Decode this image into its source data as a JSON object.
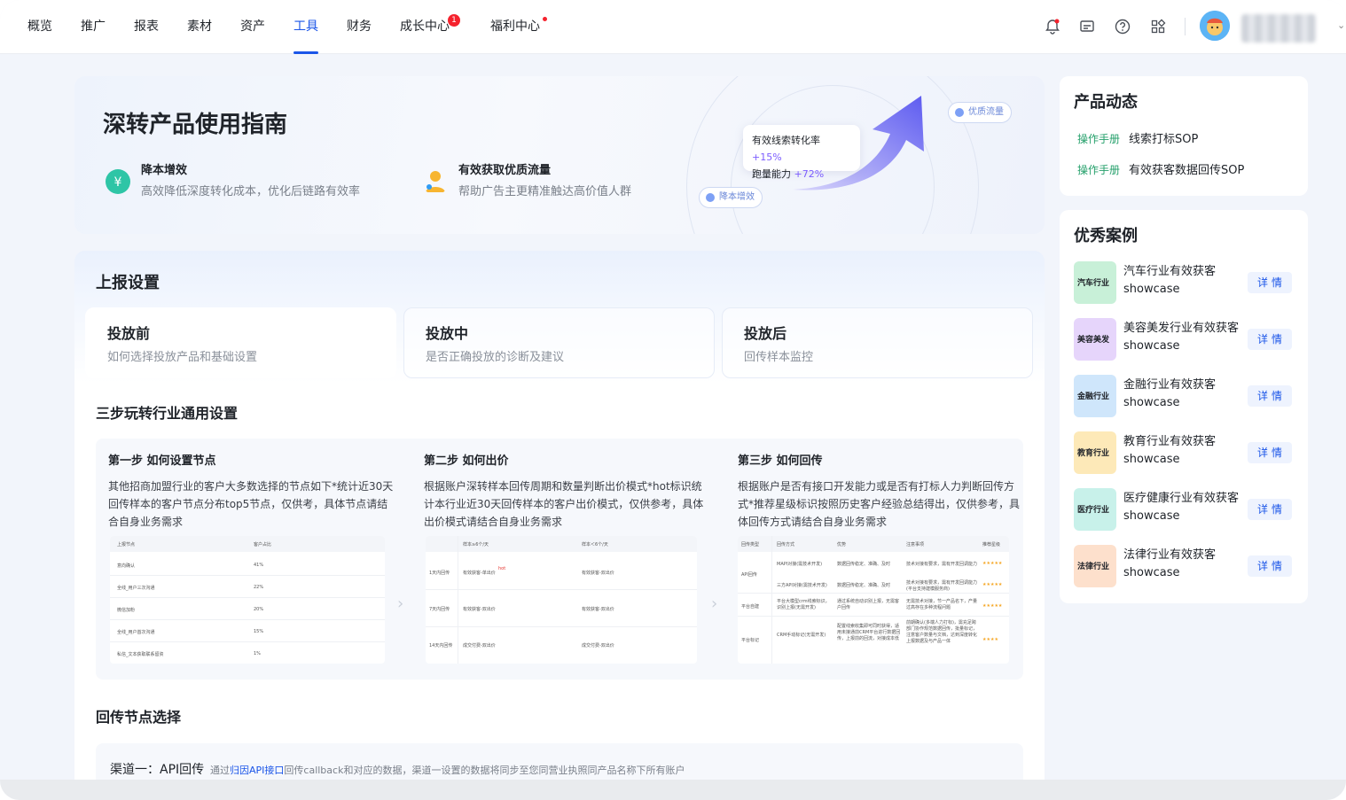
{
  "nav": {
    "items": [
      "概览",
      "推广",
      "报表",
      "素材",
      "资产",
      "工具",
      "财务",
      "成长中心",
      "福利中心"
    ],
    "active": "工具",
    "growth_badge": "1"
  },
  "toolbar": {
    "icons": [
      "bell-icon",
      "message-icon",
      "help-icon",
      "apps-icon"
    ]
  },
  "guide": {
    "title": "深转产品使用指南",
    "features": [
      {
        "title": "降本增效",
        "desc": "高效降低深度转化成本，优化后链路有效率",
        "icon": "yuan-icon"
      },
      {
        "title": "有效获取优质流量",
        "desc": "帮助广告主更精准触达高价值人群",
        "icon": "people-icon"
      }
    ],
    "card_line1_label": "有效线索转化率",
    "card_line1_value": "+15%",
    "card_line2_label": "跑量能力",
    "card_line2_value": "+72%",
    "pill_quality": "优质流量",
    "pill_cost": "降本增效"
  },
  "report": {
    "title": "上报设置",
    "tabs": [
      {
        "title": "投放前",
        "desc": "如何选择投放产品和基础设置"
      },
      {
        "title": "投放中",
        "desc": "是否正确投放的诊断及建议"
      },
      {
        "title": "投放后",
        "desc": "回传样本监控"
      }
    ],
    "steps_title": "三步玩转行业通用设置",
    "steps": [
      {
        "title": "第一步 如何设置节点",
        "desc": "其他招商加盟行业的客户大多数选择的节点如下*统计近30天回传样本的客户节点分布top5节点，仅供考，具体节点请结合自身业务需求"
      },
      {
        "title": "第二步 如何出价",
        "desc": "根据账户深转样本回传周期和数量判断出价模式*hot标识统计本行业近30天回传样本的客户出价模式，仅供参考，具体出价模式请结合自身业务需求"
      },
      {
        "title": "第三步 如何回传",
        "desc": "根据账户是否有接口开发能力或是否有打标人力判断回传方式*推荐星级标识按照历史客户经验总结得出，仅供参考，具体回传方式请结合自身业务需求"
      }
    ],
    "table1": {
      "headers": [
        "上报节点",
        "客户占比"
      ],
      "rows": [
        [
          "意向确认",
          "41%"
        ],
        [
          "全线_用户三次沟通",
          "22%"
        ],
        [
          "微信加粉",
          "20%"
        ],
        [
          "全线_用户首次沟通",
          "15%"
        ],
        [
          "私信_文本获取联系留资",
          "1%"
        ]
      ]
    },
    "table2": {
      "headers": [
        "",
        "样本≥6个/天",
        "样本＜6个/天"
      ],
      "rows": [
        [
          "1天内回传",
          "有效获客-单出价",
          "有效获客-双出价"
        ],
        [
          "7天内回传",
          "有效获客-双出价",
          "有效获客-双出价"
        ],
        [
          "14天内回传",
          "成交付费-双出价",
          "成交付费-双出价"
        ]
      ],
      "hot": "hot"
    },
    "table3": {
      "headers": [
        "回传类型",
        "回传方式",
        "优势",
        "注意事项",
        "推荐星级"
      ],
      "rows": [
        [
          "API回传",
          "MAPI对接(需技术开发)",
          "数据回传稳定、准确、及时",
          "技术对接有要求，需有开发回调能力",
          "★★★★★"
        ],
        [
          "",
          "三方API对接(需技术开发)",
          "数据回传稳定、准确、及时",
          "技术对接有要求，需有开发回调能力(平台支持建模服务商)",
          "★★★★★"
        ],
        [
          "平台自建",
          "平台大模型crm线索标识，识别上报(无需开发)",
          "通过系统自动识别上报，无需客户回传",
          "无需技术对接，节一产品名下，产量过高存在多种流程问题",
          "★★★★★"
        ],
        [
          "平台标记",
          "CRM手动标记(无需开发)",
          "配置线索收集即可同时获得，适用未接通前CRM平台进行数据回传，上报前的回流，对接成本低",
          "前期确认(多端人力打标)，需充足跨部门协作规范数据回传，批量标记，注意客户数量与文档，达到深度转化上报数据及与产品一体",
          "★★★★"
        ]
      ]
    },
    "callback_title": "回传节点选择",
    "channel": {
      "title": "渠道一：API回传",
      "desc_prefix": "通过",
      "desc_link": "归因API接口",
      "desc_suffix": "回传callback和对应的数据，渠道一设置的数据将同步至您同营业执照同产品名称下所有账户"
    }
  },
  "news": {
    "title": "产品动态",
    "items": [
      {
        "tag": "操作手册",
        "text": "线索打标SOP"
      },
      {
        "tag": "操作手册",
        "text": "有效获客数据回传SOP"
      }
    ]
  },
  "cases": {
    "title": "优秀案例",
    "button_label": "详情",
    "items": [
      {
        "thumb": "汽车行业",
        "name": "汽车行业有效获客showcase",
        "color": "#c8f0d8"
      },
      {
        "thumb": "美容美发",
        "name": "美容美发行业有效获客showcase",
        "color": "#e6d5fb"
      },
      {
        "thumb": "金融行业",
        "name": "金融行业有效获客showcase",
        "color": "#cfe6fb"
      },
      {
        "thumb": "教育行业",
        "name": "教育行业有效获客showcase",
        "color": "#fde9b8"
      },
      {
        "thumb": "医疗行业",
        "name": "医疗健康行业有效获客showcase",
        "color": "#c8f1ea"
      },
      {
        "thumb": "法律行业",
        "name": "法律行业有效获客showcase",
        "color": "#fde0cc"
      }
    ]
  },
  "colors": {
    "accent": "#1a55e8",
    "tag_green": "#25a06b",
    "badge_red": "#f5222d"
  }
}
